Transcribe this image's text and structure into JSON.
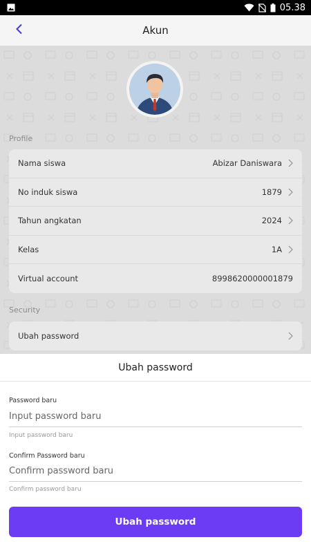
{
  "status_bar": {
    "time": "05.38",
    "icons": [
      "image-icon",
      "wifi-icon",
      "no-sim-icon",
      "battery-icon"
    ]
  },
  "header": {
    "back_icon": "chevron-left-icon",
    "title": "Akun"
  },
  "profile": {
    "section_label": "Profile",
    "rows": [
      {
        "label": "Nama siswa",
        "value": "Abizar Daniswara",
        "chevron": true
      },
      {
        "label": "No induk siswa",
        "value": "1879",
        "chevron": true
      },
      {
        "label": "Tahun angkatan",
        "value": "2024",
        "chevron": true
      },
      {
        "label": "Kelas",
        "value": "1A",
        "chevron": true
      },
      {
        "label": "Virtual account",
        "value": "8998620000001879",
        "chevron": false
      }
    ]
  },
  "security": {
    "section_label": "Security",
    "rows": [
      {
        "label": "Ubah password",
        "chevron": true
      }
    ]
  },
  "sheet": {
    "title": "Ubah password",
    "new_password": {
      "label": "Password baru",
      "placeholder": "Input password baru",
      "value": "",
      "helper": "Input password baru"
    },
    "confirm_password": {
      "label": "Confirm Password baru",
      "placeholder": "Confirm password baru",
      "value": "",
      "helper": "Confirm password baru"
    },
    "submit_label": "Ubah password"
  },
  "colors": {
    "accent": "#6c3cf5",
    "back_icon": "#4a3cc8"
  }
}
